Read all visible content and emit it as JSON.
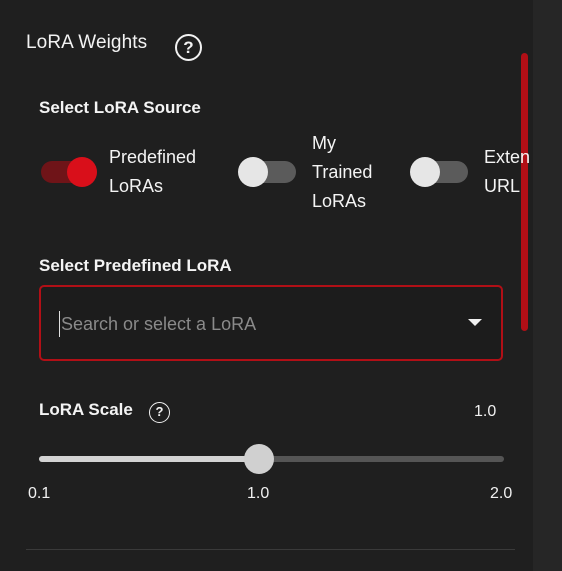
{
  "panel": {
    "title": "LoRA Weights",
    "help_glyph": "?"
  },
  "source": {
    "label": "Select LoRA Source",
    "options": [
      {
        "label": "Predefined\nLoRAs",
        "selected": true
      },
      {
        "label": "My\nTrained\nLoRAs",
        "selected": false
      },
      {
        "label": "Exten\nURL",
        "selected": false
      }
    ]
  },
  "predefined": {
    "label": "Select Predefined LoRA",
    "placeholder": "Search or select a LoRA",
    "value": ""
  },
  "scale": {
    "label": "LoRA Scale",
    "help_glyph": "?",
    "value_text": "1.0",
    "value": 1.0,
    "min": 0.1,
    "max": 2.0,
    "ticks": [
      "0.1",
      "1.0",
      "2.0"
    ]
  },
  "colors": {
    "accent": "#b10f16",
    "toggle_on": "#d90f1a",
    "background": "#1f1f1f"
  },
  "icons": {
    "panel_help": "question-circle-icon",
    "scale_help": "question-circle-icon",
    "dropdown": "caret-down-icon"
  }
}
